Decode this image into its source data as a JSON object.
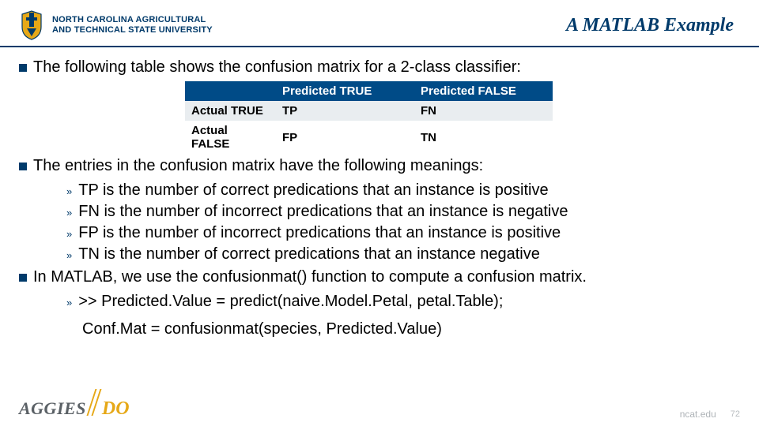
{
  "header": {
    "university_line1": "NORTH CAROLINA AGRICULTURAL",
    "university_line2": "AND TECHNICAL STATE UNIVERSITY",
    "slide_title": "A MATLAB Example"
  },
  "bullets": {
    "b1": "The following table shows the confusion matrix for a 2-class classifier:",
    "b2": "The entries in the confusion matrix have the following meanings:",
    "b3": "In MATLAB, we use the confusionmat() function to compute a confusion matrix."
  },
  "table": {
    "h_empty": "",
    "h_pred_true": "Predicted TRUE",
    "h_pred_false": "Predicted FALSE",
    "r1c1": "Actual TRUE",
    "r1c2": "TP",
    "r1c3": "FN",
    "r2c1": "Actual FALSE",
    "r2c2": "FP",
    "r2c3": "TN"
  },
  "defs": {
    "d1": "TP is the number of correct predications that an instance is positive",
    "d2": "FN is the number of incorrect predications that an instance is negative",
    "d3": "FP is the number of incorrect predications that an instance is positive",
    "d4": "TN is the number of correct predications that an instance negative"
  },
  "code": {
    "line1": ">> Predicted.Value = predict(naive.Model.Petal, petal.Table);",
    "line2": "Conf.Mat = confusionmat(species, Predicted.Value)"
  },
  "footer": {
    "aggies": "AGGIES",
    "do": "DO",
    "site": "ncat.edu",
    "page": "72"
  },
  "chart_data": {
    "type": "table",
    "title": "Confusion matrix for a 2-class classifier",
    "columns": [
      "",
      "Predicted TRUE",
      "Predicted FALSE"
    ],
    "rows": [
      {
        "label": "Actual TRUE",
        "cells": [
          "TP",
          "FN"
        ]
      },
      {
        "label": "Actual FALSE",
        "cells": [
          "FP",
          "TN"
        ]
      }
    ]
  }
}
